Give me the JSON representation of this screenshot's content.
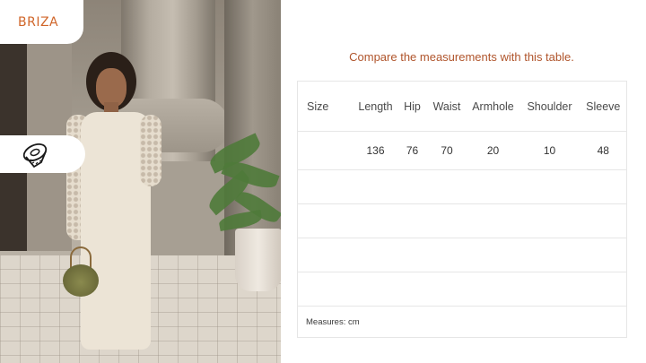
{
  "brand": {
    "logo": "BRIZA",
    "accent_color": "#d0662a"
  },
  "icons": {
    "measure_tab": "measuring-tape-icon"
  },
  "caption": "Compare the measurements with this table.",
  "size_table": {
    "columns": [
      "Size",
      "Length",
      "Hip",
      "Waist",
      "Armhole",
      "Shoulder",
      "Sleeve"
    ],
    "rows": [
      [
        "",
        "136",
        "76",
        "70",
        "20",
        "10",
        "48"
      ]
    ],
    "note": "Measures: cm"
  }
}
